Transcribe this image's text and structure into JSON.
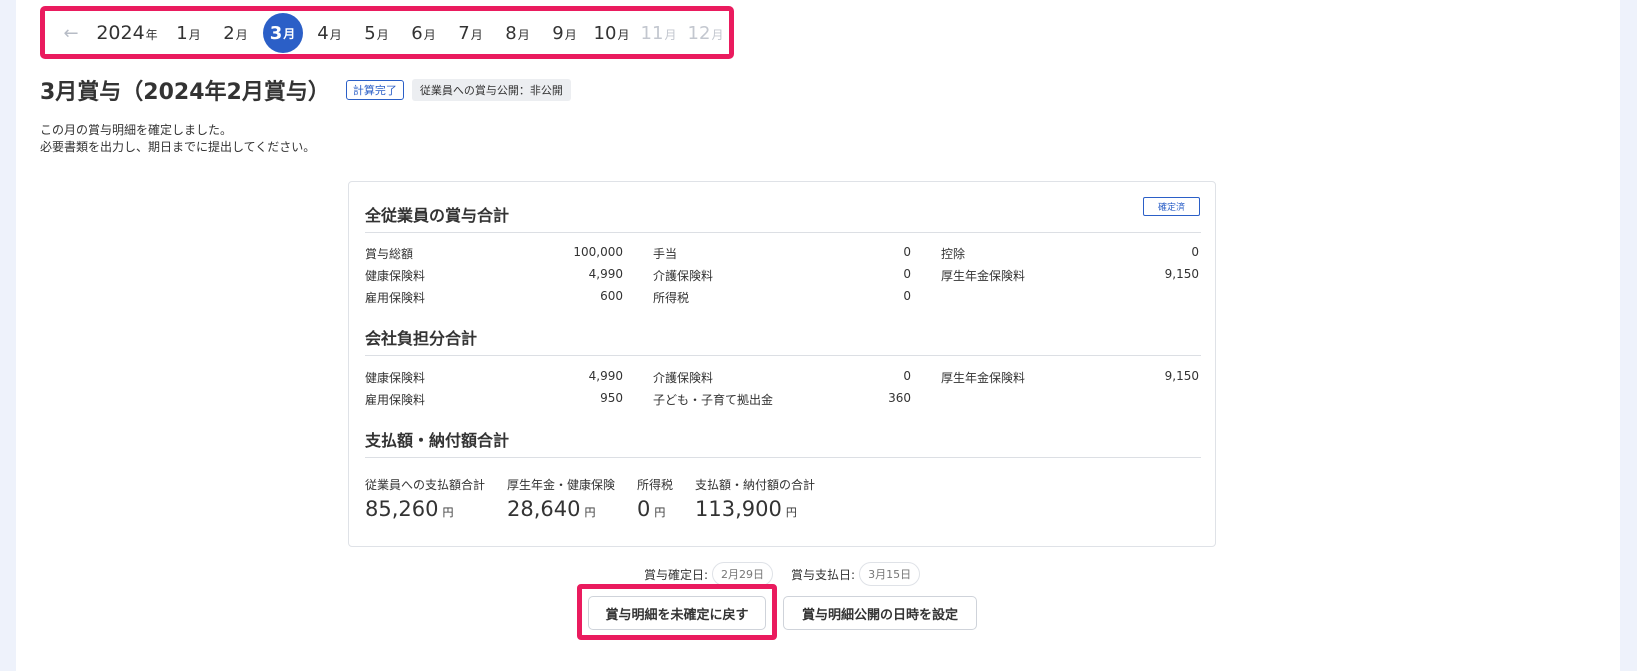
{
  "month_nav": {
    "prev_arrow": "←",
    "year": "2024",
    "year_unit": "年",
    "month_unit": "月",
    "months": [
      {
        "num": "1",
        "state": "normal"
      },
      {
        "num": "2",
        "state": "normal"
      },
      {
        "num": "3",
        "state": "active"
      },
      {
        "num": "4",
        "state": "normal"
      },
      {
        "num": "5",
        "state": "normal"
      },
      {
        "num": "6",
        "state": "normal"
      },
      {
        "num": "7",
        "state": "normal"
      },
      {
        "num": "8",
        "state": "normal"
      },
      {
        "num": "9",
        "state": "normal"
      },
      {
        "num": "10",
        "state": "normal"
      },
      {
        "num": "11",
        "state": "disabled"
      },
      {
        "num": "12",
        "state": "disabled"
      }
    ]
  },
  "header": {
    "title": "3月賞与（2024年2月賞与）",
    "status_badge": "計算完了",
    "public_badge": "従業員への賞与公開：非公開"
  },
  "description": {
    "line1": "この月の賞与明細を確定しました。",
    "line2": "必要書類を出力し、期日までに提出してください。"
  },
  "summary": {
    "confirmed_tag": "確定済",
    "employee_section": {
      "title": "全従業員の賞与合計",
      "rows": [
        [
          [
            "賞与総額",
            "100,000"
          ],
          [
            "手当",
            "0"
          ],
          [
            "控除",
            "0"
          ]
        ],
        [
          [
            "健康保険料",
            "4,990"
          ],
          [
            "介護保険料",
            "0"
          ],
          [
            "厚生年金保険料",
            "9,150"
          ]
        ],
        [
          [
            "雇用保険料",
            "600"
          ],
          [
            "所得税",
            "0"
          ],
          null
        ]
      ]
    },
    "company_section": {
      "title": "会社負担分合計",
      "rows": [
        [
          [
            "健康保険料",
            "4,990"
          ],
          [
            "介護保険料",
            "0"
          ],
          [
            "厚生年金保険料",
            "9,150"
          ]
        ],
        [
          [
            "雇用保険料",
            "950"
          ],
          [
            "子ども・子育て拠出金",
            "360"
          ],
          null
        ]
      ]
    },
    "payment_section": {
      "title": "支払額・納付額合計",
      "yen": "円",
      "totals": [
        {
          "label": "従業員への支払額合計",
          "value": "85,260"
        },
        {
          "label": "厚生年金・健康保険",
          "value": "28,640"
        },
        {
          "label": "所得税",
          "value": "0"
        },
        {
          "label": "支払額・納付額の合計",
          "value": "113,900"
        }
      ]
    }
  },
  "dates": {
    "confirm_label": "賞与確定日:",
    "confirm_value": "2月29日",
    "pay_label": "賞与支払日:",
    "pay_value": "3月15日"
  },
  "actions": {
    "revert_label": "賞与明細を未確定に戻す",
    "schedule_label": "賞与明細公開の日時を設定"
  },
  "colors": {
    "accent": "#2b5fc7",
    "highlight": "#ea1b5e",
    "background": "#eef2fb"
  }
}
